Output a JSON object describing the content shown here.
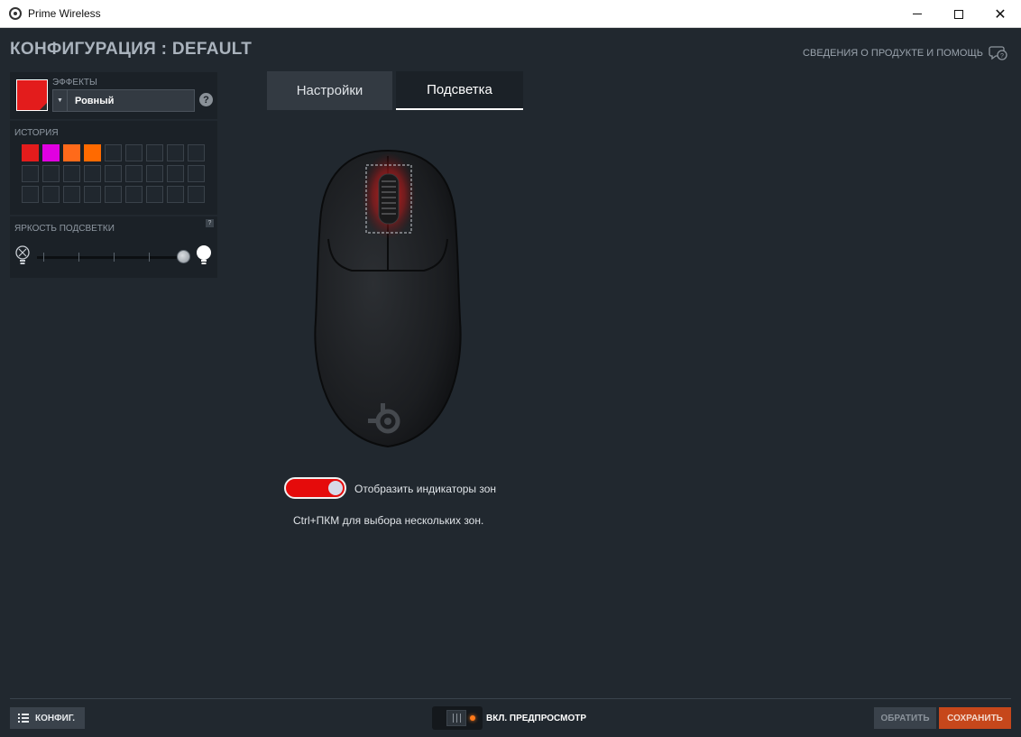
{
  "window": {
    "title": "Prime Wireless",
    "icon": "app-logo-icon",
    "controls": {
      "minimize": "minimize-icon",
      "maximize": "maximize-icon",
      "close": "✕"
    }
  },
  "header": {
    "config_title": "КОНФИГУРАЦИЯ : DEFAULT",
    "help_link": "СВЕДЕНИЯ О ПРОДУКТЕ И ПОМОЩЬ",
    "help_icon": "chat-help-icon"
  },
  "effects": {
    "label": "ЭФФЕКТЫ",
    "selected": "Ровный",
    "help": "?",
    "current_color": "#e31c1c"
  },
  "history": {
    "label": "ИСТОРИЯ",
    "colors": [
      "#e31c1c",
      "#e100e1",
      "#ff6a1a",
      "#ff6a00",
      "",
      "",
      "",
      "",
      "",
      "",
      "",
      "",
      "",
      "",
      "",
      "",
      "",
      "",
      "",
      "",
      "",
      "",
      "",
      "",
      "",
      "",
      ""
    ]
  },
  "brightness": {
    "label": "ЯРКОСТЬ ПОДСВЕТКИ",
    "help": "?",
    "value_fraction": 1.0,
    "min_icon": "bulb-off-icon",
    "max_icon": "bulb-on-icon"
  },
  "tabs": [
    {
      "label": "Настройки",
      "active": false
    },
    {
      "label": "Подсветка",
      "active": true
    }
  ],
  "device": {
    "image": "mouse-top-view",
    "zone_color": "#d01a1a"
  },
  "zones": {
    "toggle_on": true,
    "toggle_label": "Отобразить индикаторы зон",
    "hint": "Ctrl+ПКМ для выбора нескольких зон."
  },
  "footer": {
    "config_button": "КОНФИГ.",
    "preview_label": "ВКЛ. ПРЕДПРОСМОТР",
    "revert_button": "ОБРАТИТЬ",
    "save_button": "СОХРАНИТЬ"
  },
  "colors": {
    "background": "#21282f",
    "panel": "#1b2127",
    "accent_save": "#c6471b",
    "toggle_on": "#e50b0b"
  }
}
